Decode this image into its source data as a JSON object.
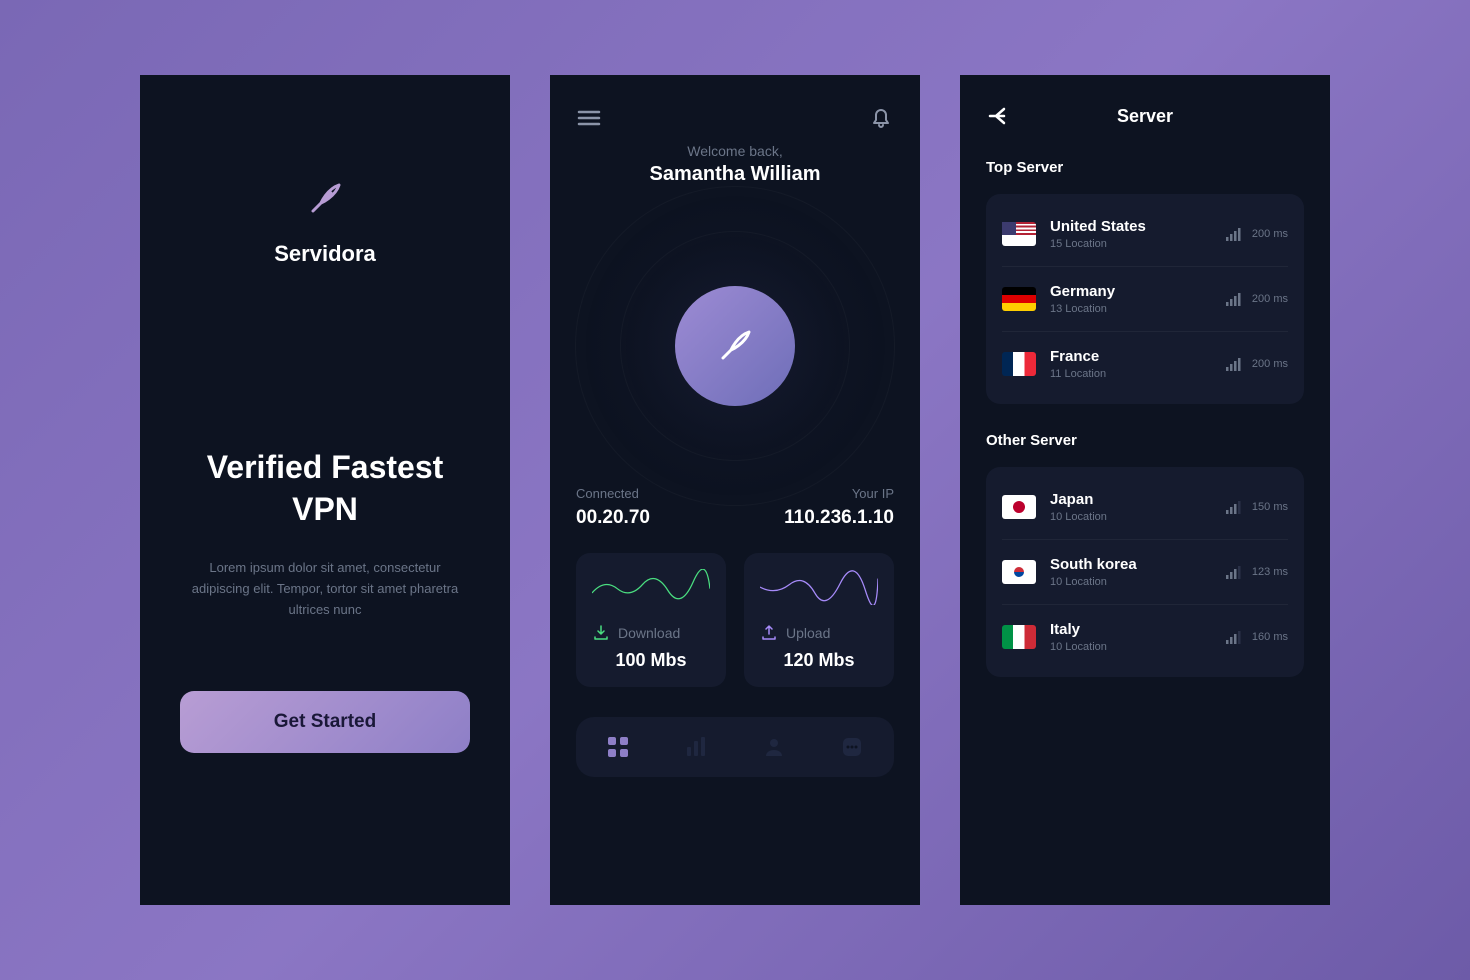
{
  "onboarding": {
    "app_name": "Servidora",
    "tagline": "Verified\nFastest VPN",
    "description": "Lorem ipsum dolor sit amet, consectetur adipiscing elit. Tempor, tortor sit amet pharetra ultrices nunc",
    "cta": "Get Started"
  },
  "home": {
    "greeting": "Welcome back,",
    "username": "Samantha William",
    "connected_label": "Connected",
    "connected_value": "00.20.70",
    "ip_label": "Your IP",
    "ip_value": "110.236.1.10",
    "download_label": "Download",
    "download_value": "100 Mbs",
    "upload_label": "Upload",
    "upload_value": "120 Mbs"
  },
  "servers": {
    "title": "Server",
    "top_label": "Top Server",
    "other_label": "Other Server",
    "top": [
      {
        "name": "United States",
        "locations": "15 Location",
        "ping": "200 ms",
        "flag": "us"
      },
      {
        "name": "Germany",
        "locations": "13 Location",
        "ping": "200 ms",
        "flag": "de"
      },
      {
        "name": "France",
        "locations": "11 Location",
        "ping": "200 ms",
        "flag": "fr"
      }
    ],
    "other": [
      {
        "name": "Japan",
        "locations": "10 Location",
        "ping": "150 ms",
        "flag": "jp"
      },
      {
        "name": "South korea",
        "locations": "10 Location",
        "ping": "123 ms",
        "flag": "kr"
      },
      {
        "name": "Italy",
        "locations": "10 Location",
        "ping": "160 ms",
        "flag": "it"
      }
    ]
  }
}
